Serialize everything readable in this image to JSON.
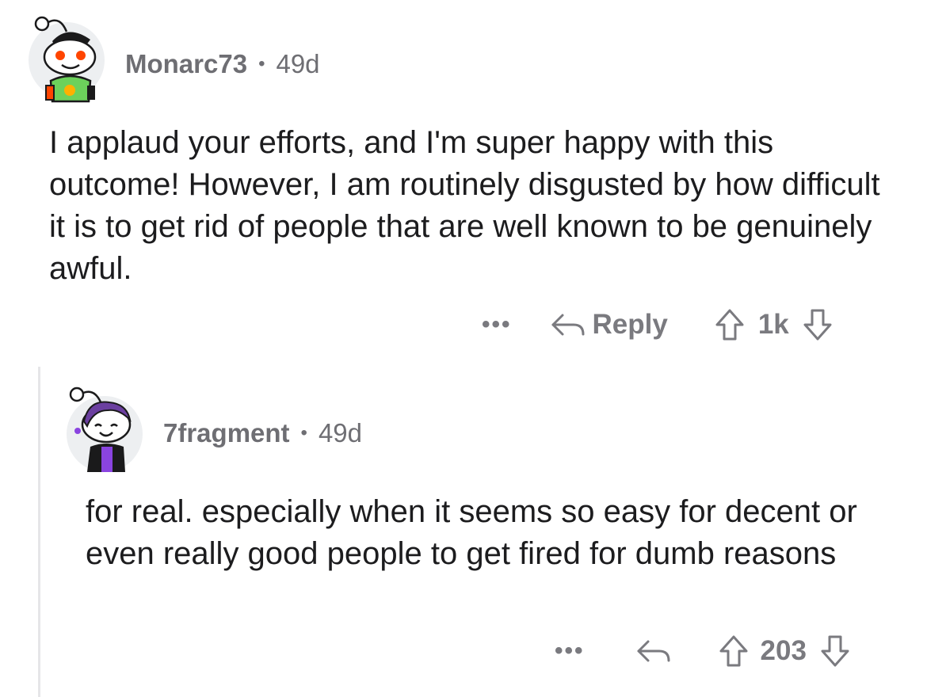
{
  "comments": [
    {
      "username": "Monarc73",
      "dot": "•",
      "age": "49d",
      "body": "I applaud your efforts, and I'm super happy with this outcome! However, I am routinely disgusted by how difficult it is to get rid of people that are well known to be genuinely awful.",
      "more": "•••",
      "reply_label": "Reply",
      "score": "1k"
    },
    {
      "username": "7fragment",
      "dot": "•",
      "age": "49d",
      "body": "for real. especially when it seems so easy for decent or even really good people to get fired for dumb reasons",
      "more": "•••",
      "score": "203"
    }
  ],
  "icons": {
    "reply": "reply-arrow-icon",
    "upvote": "upvote-arrow-icon",
    "downvote": "downvote-arrow-icon"
  },
  "colors": {
    "meta": "#6e6e73",
    "action": "#7a7a7f",
    "thread_line": "#e6e6e8"
  }
}
